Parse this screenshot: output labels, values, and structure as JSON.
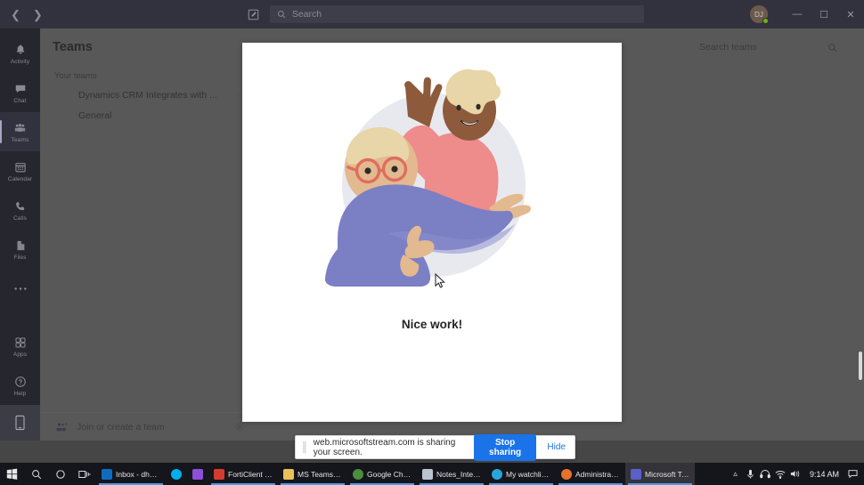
{
  "titlebar": {
    "back_icon": "chevron-left-icon",
    "forward_icon": "chevron-right-icon",
    "compose_icon": "compose-icon",
    "search_placeholder": "Search",
    "avatar_initials": "DJ",
    "minimize_label": "—",
    "maximize_label": "☐",
    "close_label": "✕"
  },
  "rail": {
    "items": [
      {
        "label": "Activity",
        "icon": "bell-icon",
        "active": false
      },
      {
        "label": "Chat",
        "icon": "chat-icon",
        "active": false
      },
      {
        "label": "Teams",
        "icon": "teams-icon",
        "active": true
      },
      {
        "label": "Calendar",
        "icon": "calendar-icon",
        "active": false
      },
      {
        "label": "Calls",
        "icon": "phone-icon",
        "active": false
      },
      {
        "label": "Files",
        "icon": "files-icon",
        "active": false
      },
      {
        "label": "",
        "icon": "more-ellipsis-icon",
        "active": false
      }
    ],
    "bottom_items": [
      {
        "label": "Apps",
        "icon": "apps-grid-icon"
      },
      {
        "label": "Help",
        "icon": "help-question-icon"
      }
    ],
    "device_icon": "mobile-device-icon"
  },
  "teams_panel": {
    "title": "Teams",
    "filter_icon": "filter-funnel-icon",
    "section_label": "Your teams",
    "teams": [
      {
        "name": "Dynamics CRM Integrates with ...",
        "more": "···"
      },
      {
        "name": "General",
        "more": ""
      }
    ],
    "join_label": "Join or create a team",
    "join_icon": "add-people-icon",
    "settings_icon": "gear-icon"
  },
  "content": {
    "search_teams_placeholder": "Search teams",
    "search_icon": "search-icon"
  },
  "modal": {
    "caption": "Nice work!",
    "illustration_name": "celebrating-people-illustration",
    "colors": {
      "circle_bg": "#e8e9ef",
      "sweater_purple": "#7b7fc4",
      "top_pink": "#ee8b8b",
      "skin_light": "#e3b98f",
      "skin_dark": "#8e5a3c",
      "hair_blonde": "#e8d5a8",
      "glasses_red": "#e06d5f"
    }
  },
  "share_bar": {
    "grip_icon": "drag-grip-icon",
    "message": "web.microsoftstream.com is sharing your screen.",
    "stop_label": "Stop sharing",
    "hide_label": "Hide",
    "accent": "#1a73e8"
  },
  "taskbar": {
    "system_icons": [
      {
        "name": "windows-start-icon"
      },
      {
        "name": "search-icon"
      },
      {
        "name": "cortana-icon"
      },
      {
        "name": "task-view-icon"
      }
    ],
    "apps": [
      {
        "label": "Inbox - dhaw...",
        "icon": "outlook-icon",
        "color": "#0f6cbd",
        "open": true,
        "active": false
      },
      {
        "label": "",
        "icon": "skype-icon",
        "color": "#00aff0",
        "open": false,
        "active": false
      },
      {
        "label": "",
        "icon": "vscode-icon",
        "color": "#8c4fd6",
        "open": false,
        "active": false
      },
      {
        "label": "FortiClient -...",
        "icon": "forticlient-icon",
        "color": "#d63b2f",
        "open": true,
        "active": false
      },
      {
        "label": "MS Teams Int...",
        "icon": "folder-icon",
        "color": "#e8c15a",
        "open": true,
        "active": false
      },
      {
        "label": "Google Chro...",
        "icon": "chrome-icon",
        "color": "#4a8f3c",
        "open": true,
        "active": false
      },
      {
        "label": "Notes_Integr...",
        "icon": "notes-icon",
        "color": "#b9c4d0",
        "open": true,
        "active": false
      },
      {
        "label": "My watchlist ...",
        "icon": "edge-icon",
        "color": "#2aa5db",
        "open": true,
        "active": false
      },
      {
        "label": "Administrati...",
        "icon": "firefox-icon",
        "color": "#e8712e",
        "open": true,
        "active": false
      },
      {
        "label": "Microsoft Te...",
        "icon": "teams-app-icon",
        "color": "#5b5fc7",
        "open": true,
        "active": true
      }
    ],
    "tray": [
      {
        "name": "show-hidden-icons-chevron"
      },
      {
        "name": "microphone-icon"
      },
      {
        "name": "headset-icon"
      },
      {
        "name": "wifi-icon"
      },
      {
        "name": "volume-icon"
      }
    ],
    "clock": "9:14 AM",
    "action_center_icon": "action-center-icon"
  }
}
